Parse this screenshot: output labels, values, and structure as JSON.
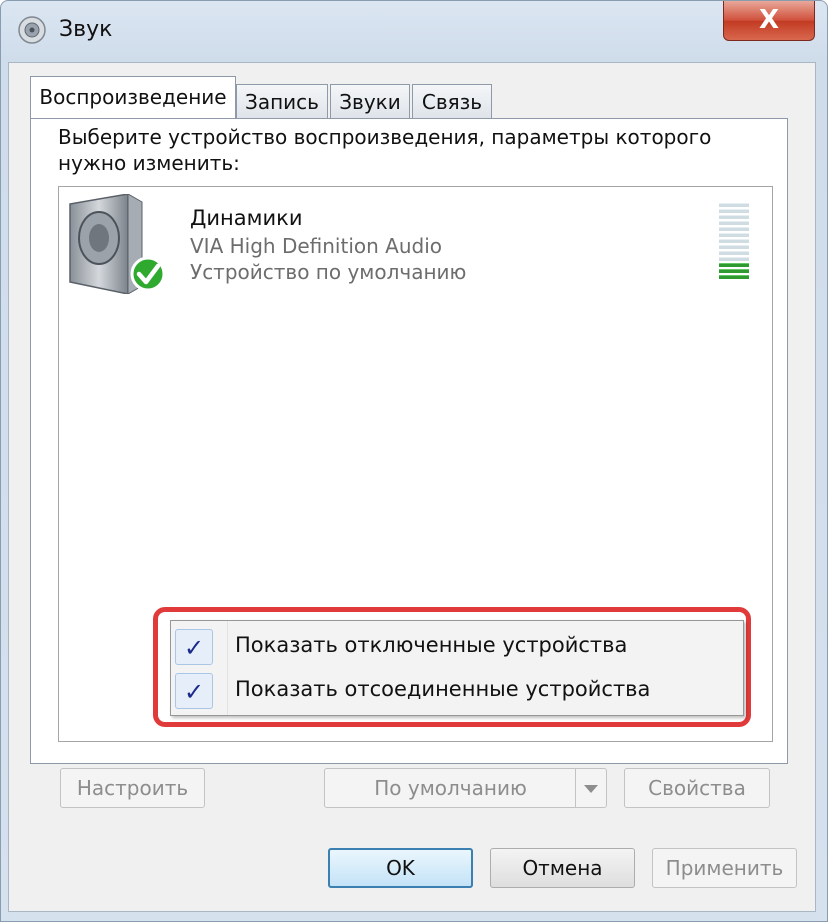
{
  "window": {
    "title": "Звук",
    "close_label": "X"
  },
  "tabs": [
    {
      "label": "Воспроизведение"
    },
    {
      "label": "Запись"
    },
    {
      "label": "Звуки"
    },
    {
      "label": "Связь"
    }
  ],
  "instruction": "Выберите устройство воспроизведения, параметры которого нужно изменить:",
  "device": {
    "name": "Динамики",
    "driver": "VIA High Definition Audio",
    "status": "Устройство по умолчанию",
    "level_bars_total": 13,
    "level_bars_active": 3
  },
  "context_menu": {
    "items": [
      {
        "label": "Показать отключенные устройства",
        "checked": true,
        "check_glyph": "✓"
      },
      {
        "label": "Показать отсоединенные устройства",
        "checked": true,
        "check_glyph": "✓"
      }
    ]
  },
  "panel_buttons": {
    "configure": "Настроить",
    "set_default": "По умолчанию",
    "properties": "Свойства"
  },
  "dialog_buttons": {
    "ok": "OK",
    "cancel": "Отмена",
    "apply": "Применить"
  },
  "colors": {
    "highlight": "#e03a3a",
    "level_on": "#2f9a2f",
    "check_badge": "#2faa2f"
  }
}
